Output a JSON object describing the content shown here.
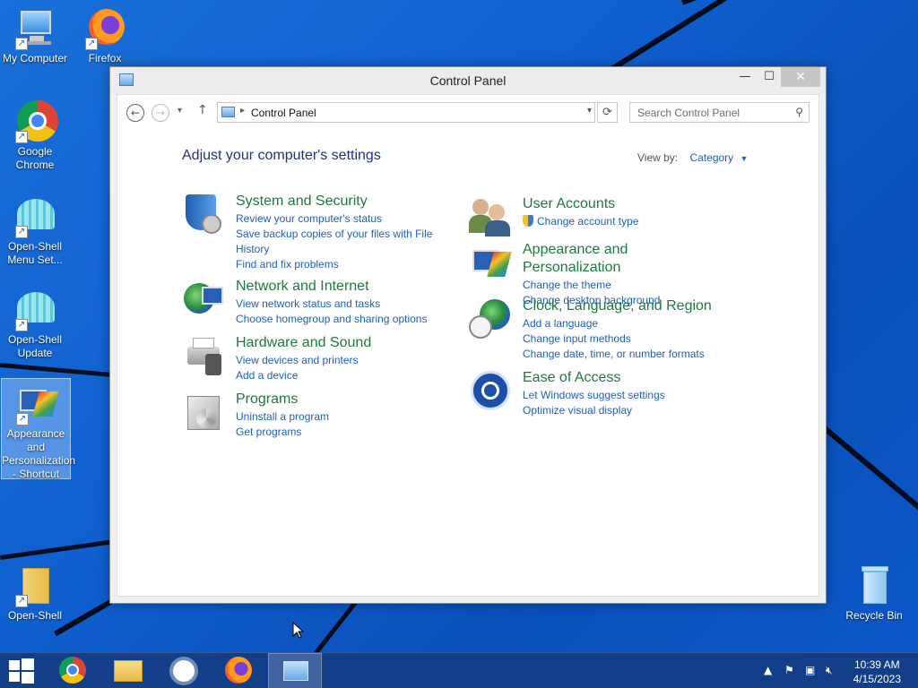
{
  "desktop": {
    "icons": [
      {
        "label": "My Computer"
      },
      {
        "label": "Firefox"
      },
      {
        "label": "Google Chrome"
      },
      {
        "label": "Open-Shell Menu Set..."
      },
      {
        "label": "Open-Shell Update"
      },
      {
        "label": "Appearance and Personalization - Shortcut"
      },
      {
        "label": "Open-Shell"
      },
      {
        "label": "Recycle Bin"
      }
    ]
  },
  "window": {
    "title": "Control Panel",
    "minimize": "—",
    "maximize": "☐",
    "close": "✕",
    "breadcrumb": "Control Panel",
    "search_placeholder": "Search Control Panel",
    "heading": "Adjust your computer's settings",
    "view_by_label": "View by:",
    "view_by_value": "Category",
    "categories": [
      {
        "title": "System and Security",
        "links": [
          "Review your computer's status",
          "Save backup copies of your files with File History",
          "Find and fix problems"
        ]
      },
      {
        "title": "Network and Internet",
        "links": [
          "View network status and tasks",
          "Choose homegroup and sharing options"
        ]
      },
      {
        "title": "Hardware and Sound",
        "links": [
          "View devices and printers",
          "Add a device"
        ]
      },
      {
        "title": "Programs",
        "links": [
          "Uninstall a program",
          "Get programs"
        ]
      },
      {
        "title": "User Accounts",
        "links": [
          "Change account type"
        ]
      },
      {
        "title": "Appearance and Personalization",
        "links": [
          "Change the theme",
          "Change desktop background"
        ]
      },
      {
        "title": "Clock, Language, and Region",
        "links": [
          "Add a language",
          "Change input methods",
          "Change date, time, or number formats"
        ]
      },
      {
        "title": "Ease of Access",
        "links": [
          "Let Windows suggest settings",
          "Optimize visual display"
        ]
      }
    ]
  },
  "taskbar": {
    "time": "10:39 AM",
    "date": "4/15/2023"
  },
  "colors": {
    "link": "#1e5fc4",
    "category_title": "#1e7a3c",
    "heading": "#1e3287",
    "taskbar": "#143c82"
  }
}
